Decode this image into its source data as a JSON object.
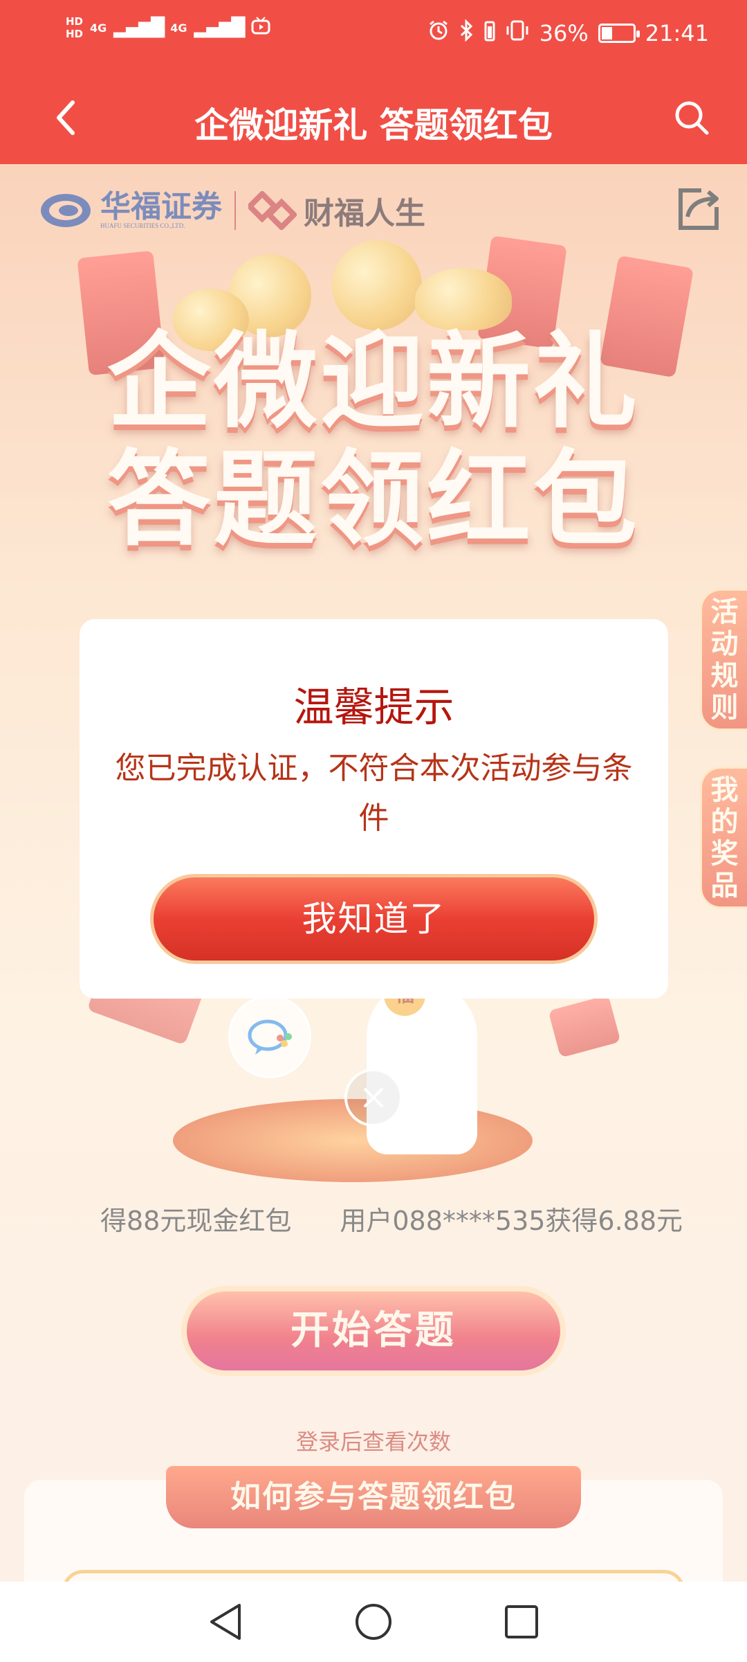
{
  "status_bar": {
    "hd1": "HD",
    "hd2": "HD",
    "network1": "4G",
    "network2": "4G",
    "battery_percent": "36%",
    "time": "21:41",
    "battery_level": 0.36
  },
  "nav": {
    "title": "企微迎新礼 答题领红包"
  },
  "brand": {
    "name1": "华福证券",
    "name1_sub": "HUAFU SECURITIES CO.,LTD.",
    "name2": "财福人生"
  },
  "banner": {
    "line1": "企微迎新礼",
    "line2": "答题领红包"
  },
  "side_tabs": {
    "rules": "活动规则",
    "prizes": "我的奖品"
  },
  "mascot_badge": "福",
  "ticker": {
    "item1": "得88元现金红包",
    "item2": "用户088****535获得6.88元"
  },
  "start_button": "开始答题",
  "login_hint": "登录后查看次数",
  "howto_title": "如何参与答题领红包",
  "dialog": {
    "title": "温馨提示",
    "message": "您已完成认证，不符合本次活动参与条件",
    "button": "我知道了"
  },
  "colors": {
    "header_red": "#f14f46",
    "dialog_title": "#b5160e",
    "dialog_text": "#b63418",
    "button_red": "#ea4033"
  }
}
